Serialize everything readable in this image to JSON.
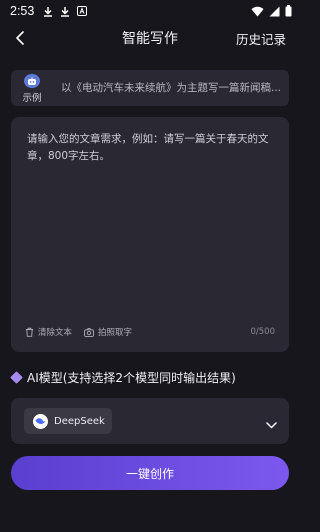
{
  "status_bar": {
    "time": "2:53"
  },
  "header": {
    "title": "智能写作",
    "history_label": "历史记录"
  },
  "example": {
    "badge_label": "示例",
    "text": "以《电动汽车未来续航》为主题写一篇新闻稿..."
  },
  "input_card": {
    "placeholder": "请输入您的文章需求，例如：请写一篇关于春天的文章，800字左右。",
    "clear_label": "清除文本",
    "photo_label": "拍照取字",
    "char_count": "0/500"
  },
  "model_section": {
    "title": "AI模型(支持选择2个模型同时输出结果)",
    "selected_model": "DeepSeek"
  },
  "actions": {
    "create_label": "一键创作"
  },
  "colors": {
    "background": "#17161d",
    "card": "#2a2933",
    "accent_start": "#5a3fd0",
    "accent_end": "#7c58ef"
  }
}
